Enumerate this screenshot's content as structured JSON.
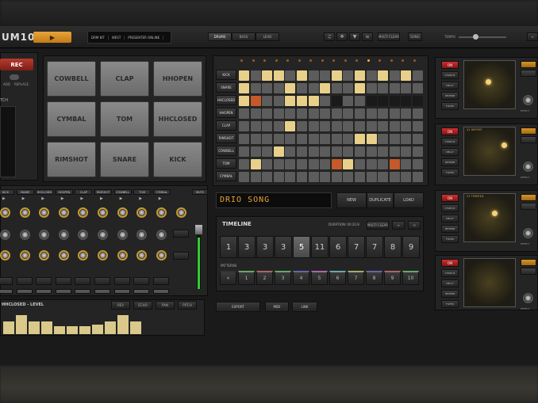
{
  "app": {
    "title": "UM10"
  },
  "transport": {
    "play_label": "▶"
  },
  "preset": {
    "slot1": "DRM KIT",
    "slot2": "WEST",
    "slot3": "PRESENTER ONLINE"
  },
  "modes": [
    "DRUMS",
    "BASS",
    "LEAD"
  ],
  "toolbar": {
    "btn1": "MULTI CLEAR",
    "btn2": "SONG",
    "tempo_label": "TEMPO"
  },
  "record": {
    "rec_label": "REC",
    "add_label": "ADD",
    "replace_label": "REPLACE",
    "patch_label": "TCH"
  },
  "pads": [
    "COWBELL",
    "CLAP",
    "HHOPEN",
    "CYMBAL",
    "TOM",
    "HHCLOSED",
    "RIMSHOT",
    "SNARE",
    "KICK"
  ],
  "sequencer": {
    "rows": [
      "KICK",
      "SNARE",
      "HHCLOSED",
      "HHOPEN",
      "CLAP",
      "RIMSHOT",
      "COWBELL",
      "TOM",
      "CYMBAL"
    ]
  },
  "song": {
    "name": "DRIO SONG",
    "new_label": "NEW",
    "duplicate_label": "DUPLICATE",
    "load_label": "LOAD"
  },
  "timeline": {
    "title": "TIMELINE",
    "duration": "DURATION: 00:20.8",
    "cells": [
      "1",
      "3",
      "3",
      "3",
      "5",
      "11",
      "6",
      "7",
      "7",
      "8",
      "9"
    ],
    "patterns_label": "PATTERNS",
    "pattern_nums": [
      "1",
      "2",
      "3",
      "4",
      "5",
      "6",
      "7",
      "8",
      "9",
      "10"
    ]
  },
  "mixer": {
    "channels": [
      "KICK",
      "SNARE",
      "HHCLOSED",
      "HHOPEN",
      "CLAP",
      "RIMSHOT",
      "COWBELL",
      "TOM",
      "CYMBAL"
    ],
    "mute_label": "MUTE"
  },
  "level": {
    "title": "HHCLOSED - LEVEL",
    "tabs": [
      "REV",
      "ECHO",
      "PAN",
      "PITCH"
    ]
  },
  "bottom": {
    "export_label": "EXPORT",
    "midi_label": "MIDI",
    "link_label": "LINK"
  },
  "fx": {
    "on_label": "ON",
    "side_items": [
      "CHORUS",
      "DELAY",
      "REVERB",
      "FILTER"
    ],
    "names": [
      "",
      "V1 REPORT",
      "V1 TIMERED",
      ""
    ],
    "effect_label": "EFFECT"
  }
}
